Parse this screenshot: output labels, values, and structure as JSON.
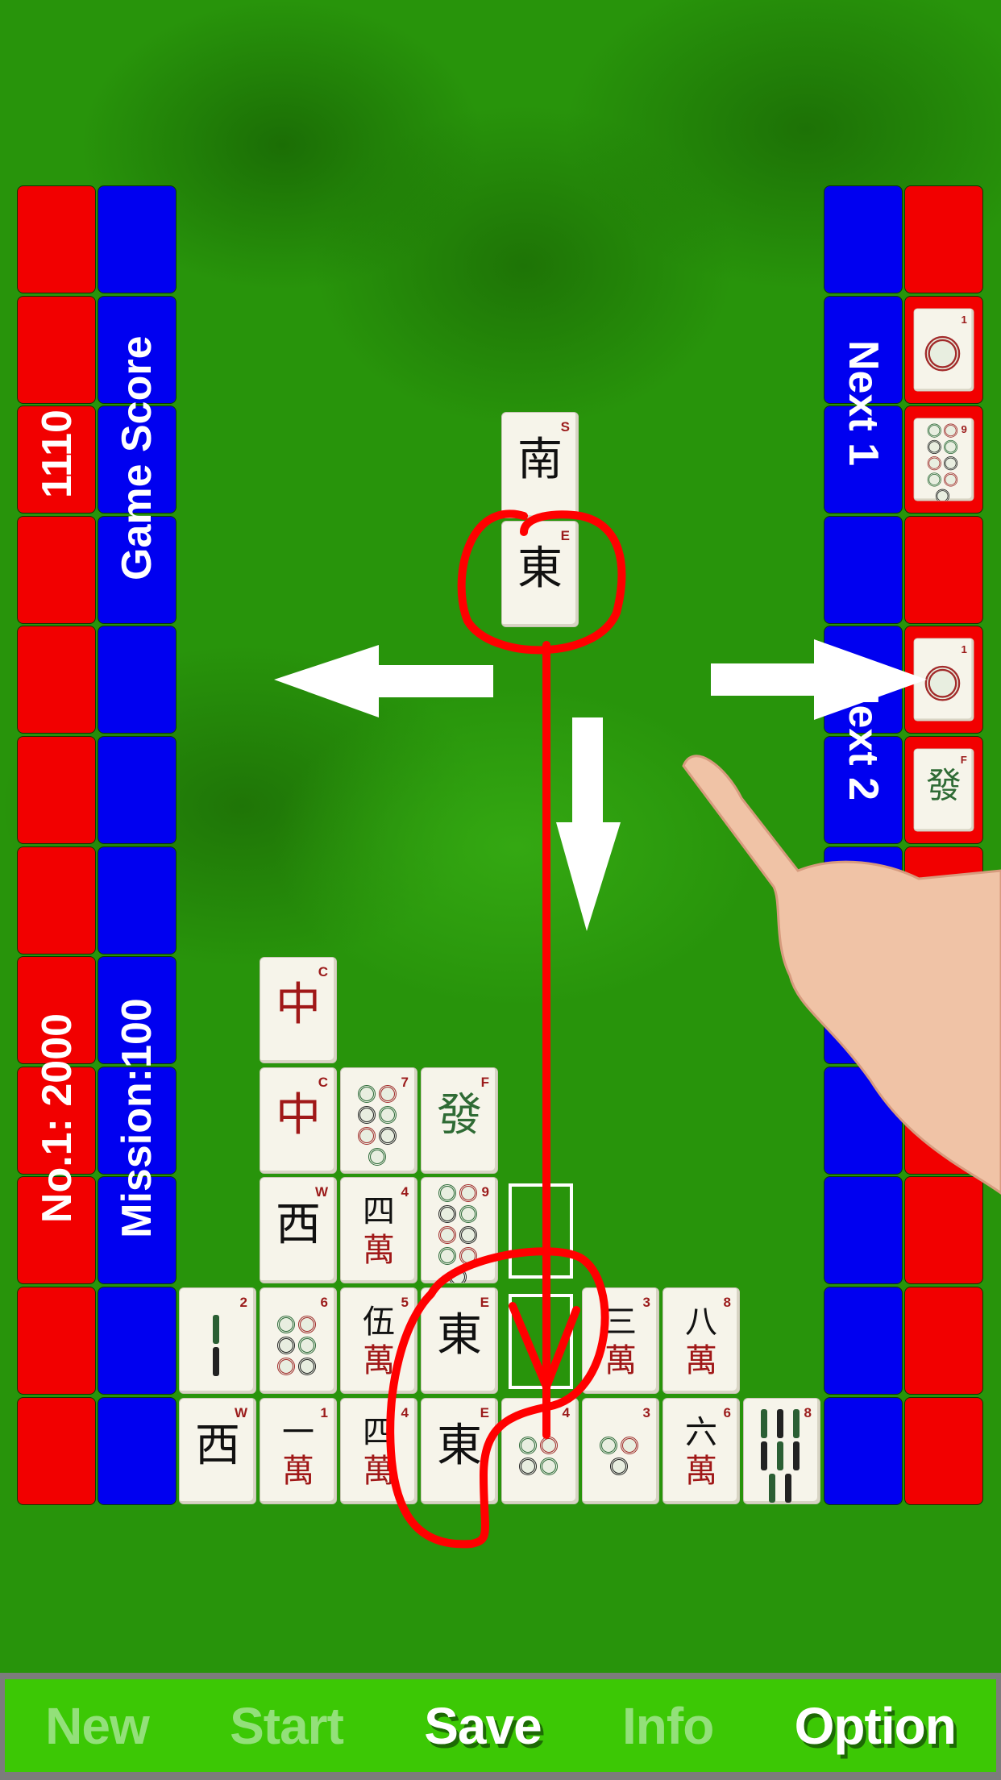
{
  "left_panel": {
    "score_value": "1110",
    "score_label": "Game Score",
    "record": "No.1: 2000",
    "mission": "Mission:100"
  },
  "right_panel": {
    "next1_label": "Next 1",
    "next2_label": "Next 2",
    "next1_tiles": [
      {
        "type": "circle",
        "n": 1,
        "corner": "1"
      },
      {
        "type": "circle",
        "n": 9,
        "corner": "9"
      }
    ],
    "next2_tiles": [
      {
        "type": "circle",
        "n": 1,
        "corner": "1"
      },
      {
        "type": "glyph",
        "glyph": "發",
        "corner": "F",
        "color": "#2f6b35"
      }
    ]
  },
  "falling_piece": [
    {
      "type": "glyph",
      "glyph": "南",
      "corner": "S",
      "color": "#111"
    },
    {
      "type": "glyph",
      "glyph": "東",
      "corner": "E",
      "color": "#111"
    }
  ],
  "board": [
    [
      null,
      null,
      null,
      null,
      null,
      null,
      null,
      null
    ],
    [
      null,
      null,
      null,
      null,
      null,
      null,
      null,
      null
    ],
    [
      null,
      null,
      null,
      null,
      null,
      null,
      null,
      null
    ],
    [
      null,
      null,
      null,
      null,
      null,
      null,
      null,
      null
    ],
    [
      null,
      null,
      null,
      null,
      null,
      null,
      null,
      null
    ],
    [
      null,
      null,
      null,
      null,
      null,
      null,
      null,
      null
    ],
    [
      null,
      null,
      null,
      null,
      null,
      null,
      null,
      null
    ],
    [
      null,
      {
        "type": "glyph",
        "glyph": "中",
        "corner": "C",
        "color": "#a01818"
      },
      null,
      null,
      null,
      null,
      null,
      null
    ],
    [
      null,
      {
        "type": "glyph",
        "glyph": "中",
        "corner": "C",
        "color": "#a01818"
      },
      {
        "type": "circle",
        "n": 7,
        "corner": "7"
      },
      {
        "type": "glyph",
        "glyph": "發",
        "corner": "F",
        "color": "#2f6b35"
      },
      null,
      null,
      null,
      null
    ],
    [
      null,
      {
        "type": "glyph",
        "glyph": "西",
        "corner": "W",
        "color": "#111"
      },
      {
        "type": "wan",
        "top": "四",
        "corner": "4"
      },
      {
        "type": "circle",
        "n": 9,
        "corner": "9"
      },
      {
        "type": "target"
      },
      null,
      null,
      null
    ],
    [
      {
        "type": "bamboo",
        "n": 2,
        "corner": "2"
      },
      {
        "type": "circle",
        "n": 6,
        "corner": "6"
      },
      {
        "type": "wan",
        "top": "伍",
        "corner": "5"
      },
      {
        "type": "glyph",
        "glyph": "東",
        "corner": "E",
        "color": "#111"
      },
      {
        "type": "target"
      },
      {
        "type": "wan",
        "top": "三",
        "corner": "3"
      },
      {
        "type": "wan",
        "top": "八",
        "corner": "8"
      },
      null
    ],
    [
      {
        "type": "glyph",
        "glyph": "西",
        "corner": "W",
        "color": "#111"
      },
      {
        "type": "wan",
        "top": "一",
        "corner": "1"
      },
      {
        "type": "wan",
        "top": "四",
        "corner": "4"
      },
      {
        "type": "glyph",
        "glyph": "東",
        "corner": "E",
        "color": "#111"
      },
      {
        "type": "circle",
        "n": 4,
        "corner": "4"
      },
      {
        "type": "circle",
        "n": 3,
        "corner": "3"
      },
      {
        "type": "wan",
        "top": "六",
        "corner": "6"
      },
      {
        "type": "bamboo",
        "n": 8,
        "corner": "8"
      }
    ]
  ],
  "wan_char": "萬",
  "toolbar": [
    {
      "label": "New",
      "enabled": false
    },
    {
      "label": "Start",
      "enabled": false
    },
    {
      "label": "Save",
      "enabled": true
    },
    {
      "label": "Info",
      "enabled": false
    },
    {
      "label": "Option",
      "enabled": true
    }
  ],
  "colors": {
    "felt": "#28940b",
    "panel_red": "#f20000",
    "panel_blue": "#0000f0",
    "toolbar": "#3cc805",
    "annotation": "#ff0000"
  }
}
